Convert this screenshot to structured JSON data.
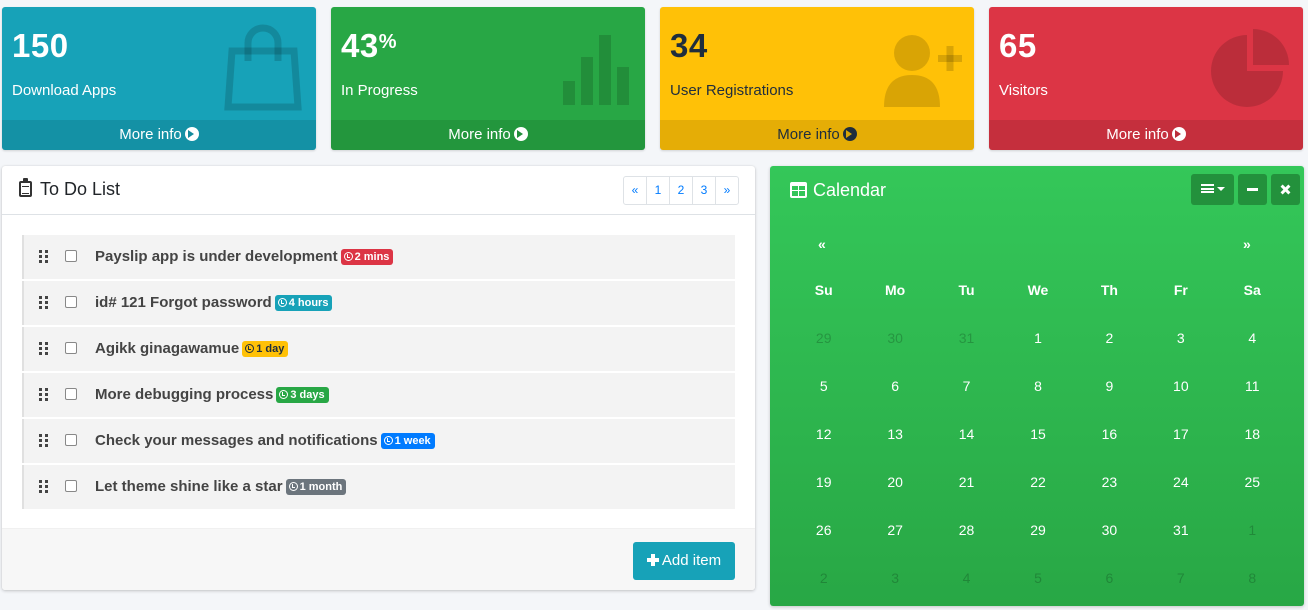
{
  "stat_boxes": [
    {
      "value": "150",
      "suffix": "",
      "label": "Download Apps",
      "link": "More info",
      "icon": "shopping-bag-icon",
      "color": "#17a2b8"
    },
    {
      "value": "43",
      "suffix": "%",
      "label": "In Progress",
      "link": "More info",
      "icon": "bar-chart-icon",
      "color": "#28a745"
    },
    {
      "value": "34",
      "suffix": "",
      "label": "User Registrations",
      "link": "More info",
      "icon": "user-plus-icon",
      "color": "#ffc107"
    },
    {
      "value": "65",
      "suffix": "",
      "label": "Visitors",
      "link": "More info",
      "icon": "pie-chart-icon",
      "color": "#dc3545"
    }
  ],
  "todo": {
    "title": "To Do List",
    "pagination": [
      "«",
      "1",
      "2",
      "3",
      "»"
    ],
    "items": [
      {
        "text": "Payslip app is under development",
        "badge": "2 mins",
        "badge_color": "#dc3545"
      },
      {
        "text": "id# 121 Forgot password",
        "badge": "4 hours",
        "badge_color": "#17a2b8"
      },
      {
        "text": "Agikk ginagawamue",
        "badge": "1 day",
        "badge_color": "#ffc107"
      },
      {
        "text": "More debugging process",
        "badge": "3 days",
        "badge_color": "#28a745"
      },
      {
        "text": "Check your messages and notifications",
        "badge": "1 week",
        "badge_color": "#007bff"
      },
      {
        "text": "Let theme shine like a star",
        "badge": "1 month",
        "badge_color": "#6c757d"
      }
    ],
    "add_button": "Add item"
  },
  "calendar": {
    "title": "Calendar",
    "prev": "«",
    "next": "»",
    "weekdays": [
      "Su",
      "Mo",
      "Tu",
      "We",
      "Th",
      "Fr",
      "Sa"
    ],
    "weeks": [
      [
        "29",
        "30",
        "31",
        "1",
        "2",
        "3",
        "4"
      ],
      [
        "5",
        "6",
        "7",
        "8",
        "9",
        "10",
        "11"
      ],
      [
        "12",
        "13",
        "14",
        "15",
        "16",
        "17",
        "18"
      ],
      [
        "19",
        "20",
        "21",
        "22",
        "23",
        "24",
        "25"
      ],
      [
        "26",
        "27",
        "28",
        "29",
        "30",
        "31",
        "1"
      ],
      [
        "2",
        "3",
        "4",
        "5",
        "6",
        "7",
        "8"
      ]
    ],
    "muted_days": {
      "0": [
        0,
        1,
        2
      ],
      "4": [
        6
      ],
      "5": [
        0,
        1,
        2,
        3,
        4,
        5,
        6
      ]
    },
    "accent": "#28a745"
  }
}
